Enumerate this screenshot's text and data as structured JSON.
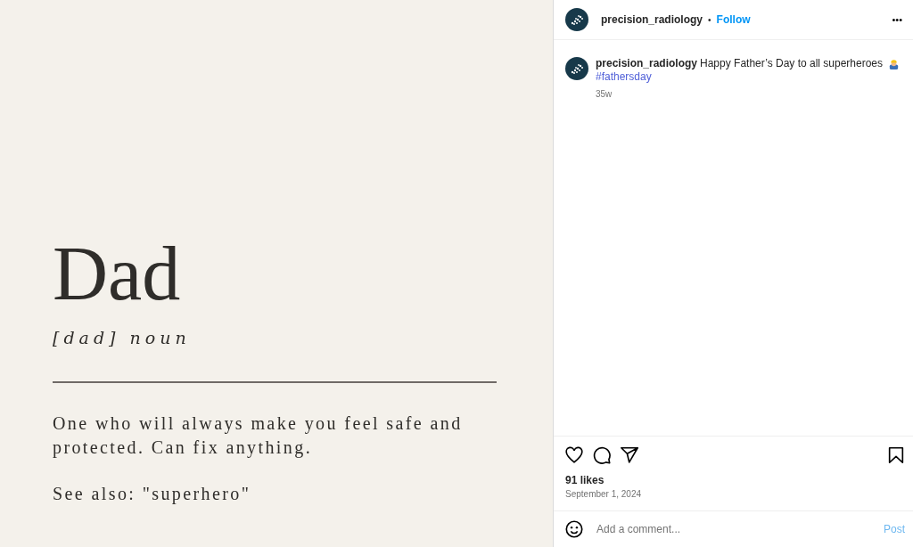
{
  "post_image": {
    "headword": "Dad",
    "pronunciation": "[dad] noun",
    "definition": "One who will always make you feel safe and protected. Can fix anything.",
    "see_also": "See also: \"superhero\""
  },
  "header": {
    "username": "precision_radiology",
    "separator": "•",
    "follow": "Follow",
    "more": "•••"
  },
  "caption": {
    "username": "precision_radiology",
    "text": "Happy Father’s Day to all superheroes",
    "hashtag": "#fathersday",
    "age": "35w"
  },
  "actions": {
    "liked": false,
    "saved": false
  },
  "likes": "91 likes",
  "date": "September 1, 2024",
  "comment": {
    "placeholder": "Add a comment...",
    "post": "Post",
    "post_disabled": true
  }
}
